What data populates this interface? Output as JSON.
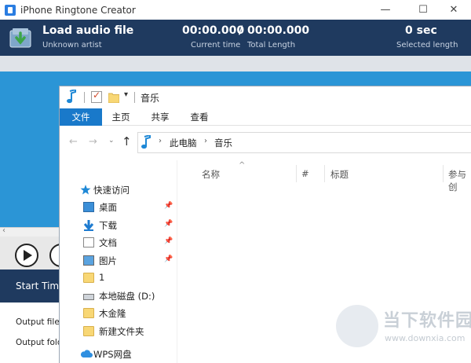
{
  "app": {
    "title": "iPhone Ringtone Creator",
    "window_controls": {
      "minimize": "—",
      "maximize": "☐",
      "close": "✕"
    },
    "header": {
      "load_title": "Load audio file",
      "artist": "Unknown artist",
      "current_time": "00:00.000",
      "separator": "/",
      "total_length": "00:00.000",
      "current_time_label": "Current time",
      "total_length_label": "Total Length",
      "seconds_value": "0 sec",
      "seconds_label": "Selected length"
    },
    "scroll_arrow": "‹",
    "start_time_label": "Start Time",
    "output_file_label": "Output file n",
    "output_folder_label": "Output folde",
    "colors": {
      "header_bg": "#1f3a5f",
      "wave_bg": "#2b95d6",
      "file_tab": "#1979ca"
    }
  },
  "explorer": {
    "title": "音乐",
    "quick_access_dropdown": "▾",
    "ribbon": {
      "file": "文件",
      "home": "主页",
      "share": "共享",
      "view": "查看"
    },
    "nav": {
      "back": "←",
      "forward": "→",
      "recent": "⌄",
      "up": "↑",
      "chevron": "›",
      "path": [
        "此电脑",
        "音乐"
      ]
    },
    "tree": [
      {
        "label": "快速访问",
        "icon": "star-icon"
      },
      {
        "label": "桌面",
        "icon": "desktop-icon",
        "pinned": true
      },
      {
        "label": "下载",
        "icon": "download-icon",
        "pinned": true
      },
      {
        "label": "文档",
        "icon": "document-icon",
        "pinned": true
      },
      {
        "label": "图片",
        "icon": "picture-icon",
        "pinned": true
      },
      {
        "label": "1",
        "icon": "folder-icon"
      },
      {
        "label": "本地磁盘 (D:)",
        "icon": "drive-icon"
      },
      {
        "label": "木金隆",
        "icon": "folder-icon"
      },
      {
        "label": "新建文件夹",
        "icon": "folder-icon"
      },
      {
        "label": "WPS网盘",
        "icon": "cloud-icon"
      }
    ],
    "pin_glyph": "📌",
    "columns": {
      "sort": "^",
      "name": "名称",
      "number": "#",
      "title": "标题",
      "artist": "参与创"
    }
  },
  "watermark": {
    "text": "当下软件园",
    "url": "www.downxia.com"
  }
}
